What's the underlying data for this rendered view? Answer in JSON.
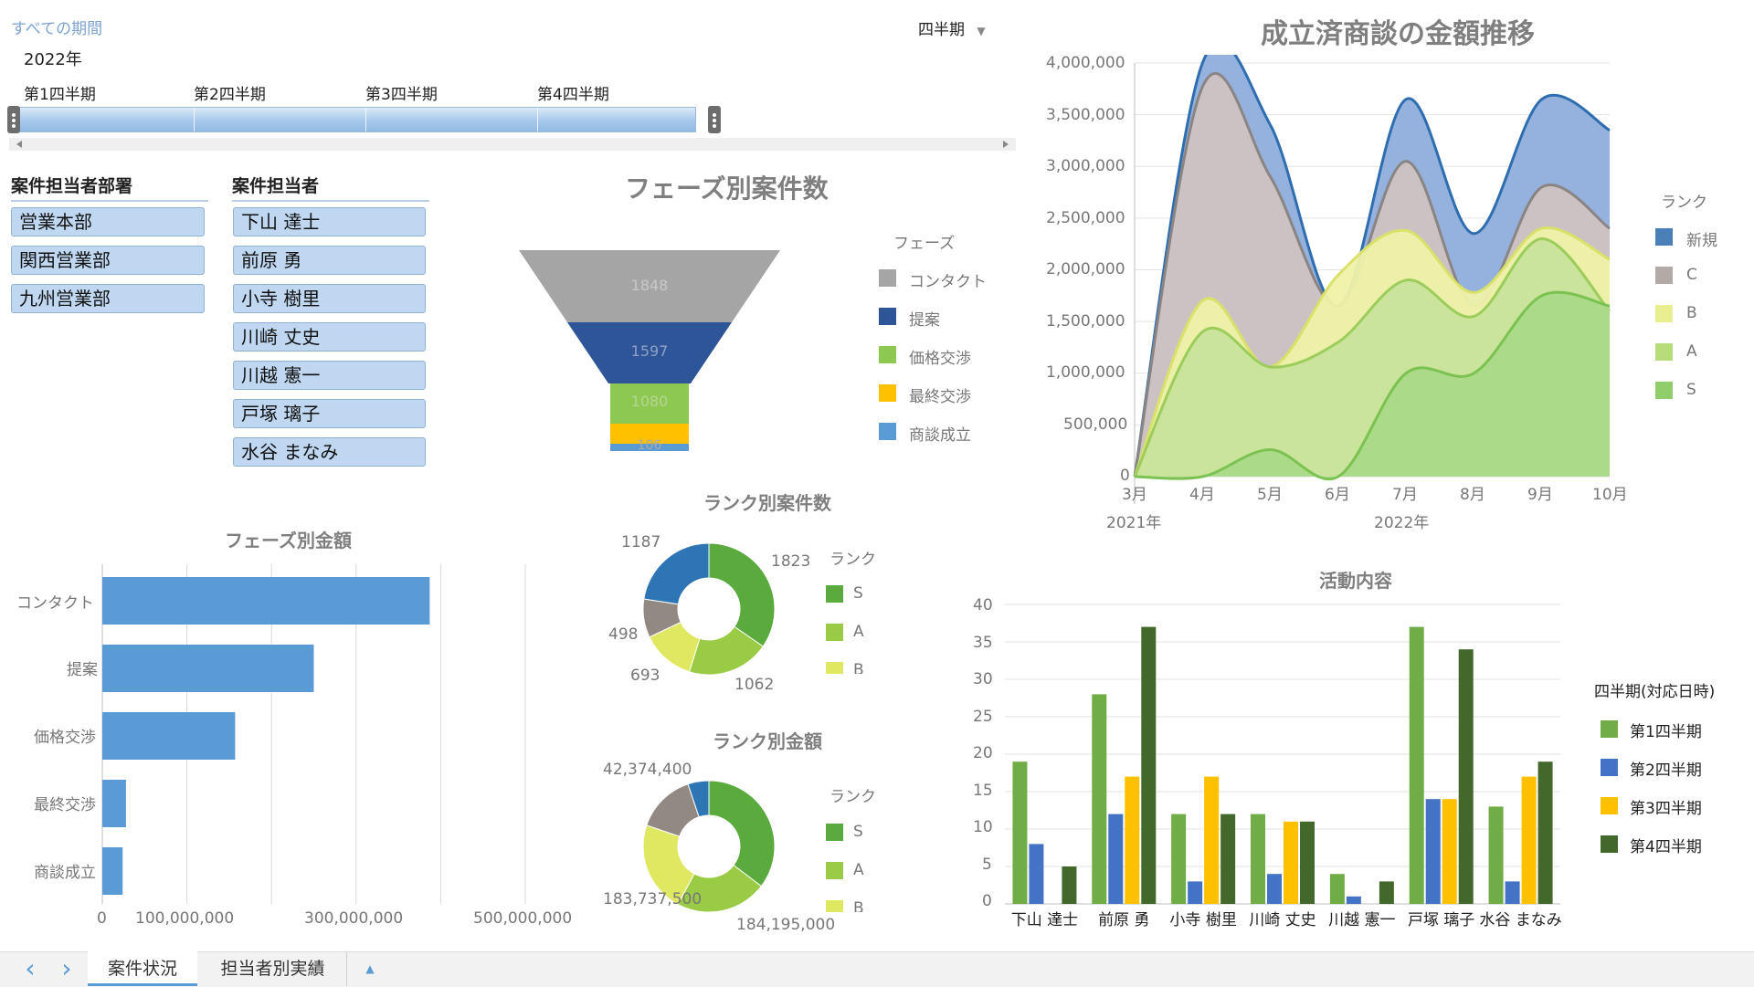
{
  "timeline": {
    "all_periods": "すべての期間",
    "year": "2022年",
    "granularity": "四半期",
    "granularity_arrow": "▼",
    "quarters": [
      "第1四半期",
      "第2四半期",
      "第3四半期",
      "第4四半期"
    ]
  },
  "slicers": {
    "dept": {
      "title": "案件担当者部署",
      "items": [
        "営業本部",
        "関西営業部",
        "九州営業部"
      ]
    },
    "person": {
      "title": "案件担当者",
      "items": [
        "下山 達士",
        "前原 勇",
        "小寺 樹里",
        "川崎 丈史",
        "川越 憲一",
        "戸塚 璃子",
        "水谷 まなみ"
      ]
    }
  },
  "funnel": {
    "title": "フェーズ別案件数",
    "legend_title": "フェーズ",
    "stages": [
      {
        "name": "コンタクト",
        "value": 1848,
        "color": "#a5a5a5"
      },
      {
        "name": "提案",
        "value": 1597,
        "color": "#2e5597"
      },
      {
        "name": "価格交渉",
        "value": 1080,
        "color": "#8dc850"
      },
      {
        "name": "最終交渉",
        "value": null,
        "color": "#ffc000"
      },
      {
        "name": "商談成立",
        "value": 106,
        "color": "#5b9bd5"
      }
    ]
  },
  "donut_count": {
    "title": "ランク別案件数",
    "legend_title": "ランク",
    "legend": [
      {
        "name": "S",
        "color": "#5aaa3d"
      },
      {
        "name": "A",
        "color": "#9acb45"
      },
      {
        "name": "B",
        "color": "#dfe860"
      }
    ],
    "labels": {
      "top_left": "1187",
      "top_right": "1823",
      "left": "498",
      "bottom_left": "693",
      "bottom_right": "1062"
    }
  },
  "donut_amount": {
    "title": "ランク別金額",
    "legend_title": "ランク",
    "legend": [
      {
        "name": "S",
        "color": "#5aaa3d"
      },
      {
        "name": "A",
        "color": "#9acb45"
      },
      {
        "name": "B",
        "color": "#dfe860"
      }
    ],
    "labels": {
      "top_left": "42,374,400",
      "bottom_left": "183,737,500",
      "bottom_right": "184,195,000"
    }
  },
  "bar_phase": {
    "title": "フェーズ別金額",
    "categories": [
      "コンタクト",
      "提案",
      "価格交渉",
      "最終交渉",
      "商談成立"
    ],
    "x_ticks": [
      "0",
      "100,000,000",
      "300,000,000",
      "500,000,000"
    ]
  },
  "area_chart": {
    "title": "成立済商談の金額推移",
    "legend_title": "ランク",
    "y_ticks": [
      "4,000,000",
      "3,500,000",
      "3,000,000",
      "2,500,000",
      "2,000,000",
      "1,500,000",
      "1,000,000",
      "500,000",
      "0"
    ],
    "x_ticks": [
      "3月",
      "4月",
      "5月",
      "6月",
      "7月",
      "8月",
      "9月",
      "10月"
    ],
    "year_labels": [
      "2021年",
      "2022年"
    ],
    "legend": [
      {
        "name": "新規",
        "color": "#4a7fb8"
      },
      {
        "name": "C",
        "color": "#b3a9a7"
      },
      {
        "name": "B",
        "color": "#e9ef91"
      },
      {
        "name": "A",
        "color": "#b7dc7a"
      },
      {
        "name": "S",
        "color": "#8fce6a"
      }
    ]
  },
  "activity_chart": {
    "title": "活動内容",
    "legend_title": "四半期(対応日時)",
    "legend": [
      {
        "name": "第1四半期",
        "color": "#70ad47"
      },
      {
        "name": "第2四半期",
        "color": "#4472c4"
      },
      {
        "name": "第3四半期",
        "color": "#ffc000"
      },
      {
        "name": "第4四半期",
        "color": "#43682b"
      }
    ],
    "y_ticks": [
      "40",
      "35",
      "30",
      "25",
      "20",
      "15",
      "10",
      "5",
      "0"
    ]
  },
  "tabs": {
    "prev": "‹",
    "next": "›",
    "items": [
      "案件状況",
      "担当者別実績"
    ],
    "add": "▲"
  },
  "chart_data": [
    {
      "type": "bar",
      "title": "フェーズ別案件数",
      "categories": [
        "コンタクト",
        "提案",
        "価格交渉",
        "最終交渉",
        "商談成立"
      ],
      "values": [
        1848,
        1597,
        1080,
        270,
        106
      ]
    },
    {
      "type": "pie",
      "title": "ランク別案件数",
      "categories": [
        "S",
        "A",
        "B",
        "C",
        "新規"
      ],
      "values": [
        1823,
        1062,
        693,
        498,
        1187
      ]
    },
    {
      "type": "pie",
      "title": "ランク別金額",
      "categories": [
        "S",
        "A",
        "B",
        "C",
        "新規"
      ],
      "values": [
        290000000,
        184195000,
        183737500,
        120000000,
        42374400
      ]
    },
    {
      "type": "bar",
      "title": "フェーズ別金額",
      "categories": [
        "コンタクト",
        "提案",
        "価格交渉",
        "最終交渉",
        "商談成立"
      ],
      "values": [
        387000000,
        250000000,
        157000000,
        28000000,
        24000000
      ],
      "xlim": [
        0,
        500000000
      ]
    },
    {
      "type": "area",
      "title": "成立済商談の金額推移",
      "x": [
        "3月",
        "4月",
        "5月",
        "6月",
        "7月",
        "8月",
        "9月",
        "10月"
      ],
      "ylim": [
        0,
        4000000
      ],
      "series": [
        {
          "name": "S",
          "values": [
            0,
            0,
            260000,
            0,
            1000000,
            1000000,
            1750000,
            1650000
          ]
        },
        {
          "name": "A",
          "values": [
            0,
            1400000,
            1060000,
            1300000,
            1900000,
            1550000,
            2300000,
            1600000
          ]
        },
        {
          "name": "B",
          "values": [
            0,
            1700000,
            1060000,
            1950000,
            2380000,
            1780000,
            2400000,
            2100000
          ]
        },
        {
          "name": "C",
          "values": [
            0,
            3770000,
            2900000,
            1650000,
            3050000,
            1650000,
            2800000,
            2400000
          ]
        },
        {
          "name": "新規",
          "values": [
            0,
            4000000,
            3400000,
            1650000,
            3650000,
            2350000,
            3650000,
            3350000
          ]
        }
      ]
    },
    {
      "type": "bar",
      "title": "活動内容",
      "categories": [
        "下山 達士",
        "前原 勇",
        "小寺 樹里",
        "川崎 丈史",
        "川越 憲一",
        "戸塚 璃子",
        "水谷 まなみ"
      ],
      "ylim": [
        0,
        40
      ],
      "series": [
        {
          "name": "第1四半期",
          "values": [
            19,
            28,
            12,
            12,
            4,
            37,
            13
          ]
        },
        {
          "name": "第2四半期",
          "values": [
            8,
            12,
            3,
            4,
            1,
            14,
            3
          ]
        },
        {
          "name": "第3四半期",
          "values": [
            0,
            17,
            17,
            11,
            0,
            14,
            17
          ]
        },
        {
          "name": "第4四半期",
          "values": [
            5,
            37,
            12,
            11,
            3,
            34,
            19
          ]
        }
      ]
    }
  ]
}
